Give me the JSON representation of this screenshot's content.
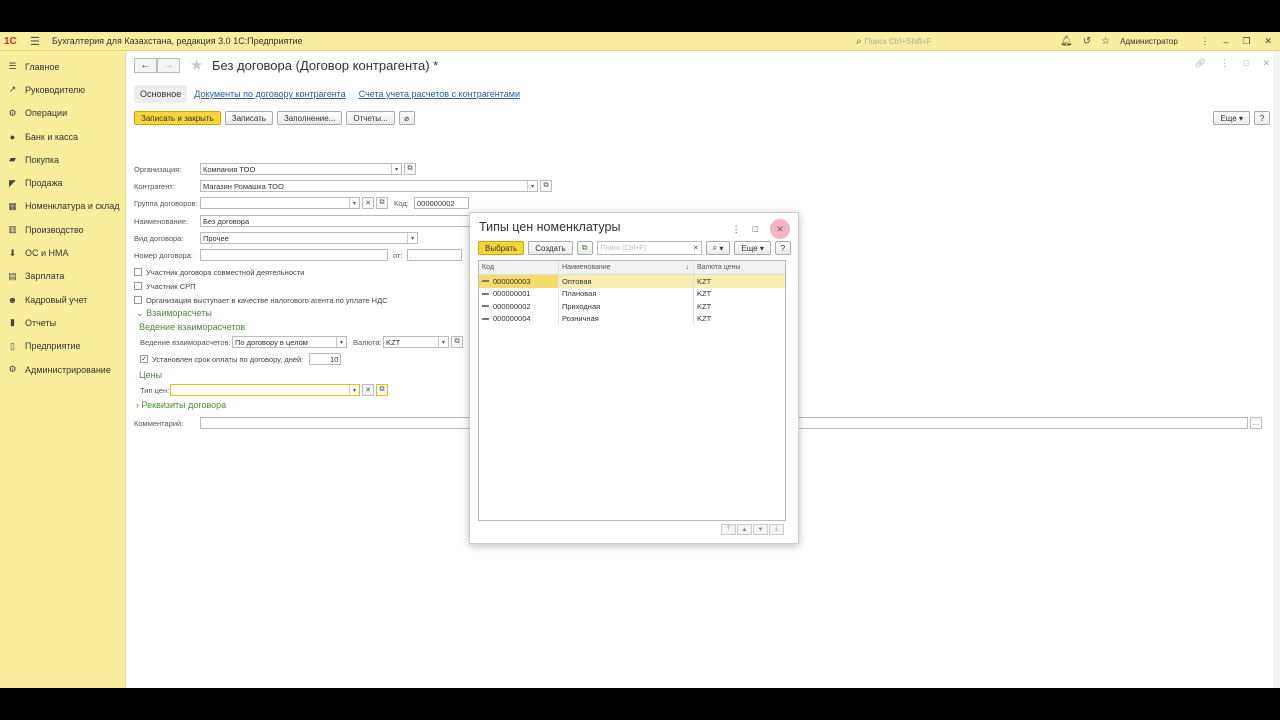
{
  "topbar": {
    "logo": "1С",
    "app_title": "Бухгалтерия для Казахстана, редакция 3.0 1С:Предприятие",
    "search_placeholder": "Поиск Ctrl+Shift+F",
    "user": "Администратор"
  },
  "sidebar": {
    "items": [
      {
        "label": "Главное",
        "icon": "menu-icon"
      },
      {
        "label": "Руководителю",
        "icon": "chart-line-icon"
      },
      {
        "label": "Операции",
        "icon": "operations-icon"
      },
      {
        "label": "Банк и касса",
        "icon": "bank-icon"
      },
      {
        "label": "Покупка",
        "icon": "cart-icon"
      },
      {
        "label": "Продажа",
        "icon": "sale-icon"
      },
      {
        "label": "Номенклатура и склад",
        "icon": "warehouse-icon"
      },
      {
        "label": "Производство",
        "icon": "production-icon"
      },
      {
        "label": "ОС и НМА",
        "icon": "assets-icon"
      },
      {
        "label": "Зарплата",
        "icon": "salary-icon"
      },
      {
        "label": "Кадровый учет",
        "icon": "personnel-icon"
      },
      {
        "label": "Отчеты",
        "icon": "reports-icon"
      },
      {
        "label": "Предприятие",
        "icon": "enterprise-icon"
      },
      {
        "label": "Администрирование",
        "icon": "gear-icon"
      }
    ]
  },
  "form": {
    "title": "Без договора (Договор контрагента) *",
    "tabs": [
      "Основное",
      "Документы по договору контрагента",
      "Счета учета расчетов с контрагентами"
    ],
    "buttons": {
      "save_close": "Записать и закрыть",
      "save": "Записать",
      "fill": "Заполнение...",
      "reports": "Отчеты...",
      "more": "Еще",
      "help": "?"
    },
    "fields": {
      "org_label": "Организация:",
      "org_value": "Компания ТОО",
      "contractor_label": "Контрагент:",
      "contractor_value": "Магазин Ромашка ТОО",
      "group_label": "Группа договоров:",
      "group_value": "",
      "code_label": "Код:",
      "code_value": "000000002",
      "name_label": "Наименование:",
      "name_value": "Без договора",
      "kind_label": "Вид договора:",
      "kind_value": "Прочее",
      "number_label": "Номер договора:",
      "number_value": "",
      "from_label": "от:",
      "from_value": ". .",
      "joint_activity": "Участник договора совместной деятельности",
      "srp": "Участник СРП",
      "tax_agent": "Организация выступает в качестве налогового агента по уплате НДС",
      "settlements_section": "Взаиморасчеты",
      "settlements_sub": "Ведение взаиморасчетов",
      "settlements_label": "Ведение взаиморасчетов:",
      "settlements_value": "По договору в целом",
      "currency_label": "Валюта:",
      "currency_value": "KZT",
      "payment_term": "Установлен срок оплаты по договору, дней:",
      "payment_days": "10",
      "prices_section": "Цены",
      "price_type_label": "Тип цен:",
      "price_type_value": "",
      "requisites_section": "Реквизиты договора",
      "comment_label": "Комментарий:",
      "comment_value": ""
    }
  },
  "modal": {
    "title": "Типы цен номенклатуры",
    "select_btn": "Выбрать",
    "create_btn": "Создать",
    "search_placeholder": "Поиск (Ctrl+F)",
    "more_btn": "Еще",
    "help_btn": "?",
    "columns": [
      "Код",
      "Наименование",
      "Валюта цены"
    ],
    "rows": [
      {
        "code": "000000003",
        "name": "Оптовая",
        "currency": "KZT"
      },
      {
        "code": "000000001",
        "name": "Плановая",
        "currency": "KZT"
      },
      {
        "code": "000000002",
        "name": "Приходная",
        "currency": "KZT"
      },
      {
        "code": "000000004",
        "name": "Розничная",
        "currency": "KZT"
      }
    ]
  }
}
